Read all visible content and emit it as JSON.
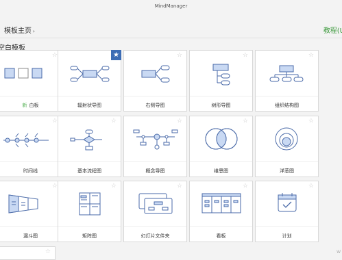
{
  "window": {
    "title": "MindManager"
  },
  "nav": {
    "home_label": "模板主页",
    "chevron": "›",
    "tutorial_label": "教程(U"
  },
  "section": {
    "title": "空白模板"
  },
  "templates": [
    {
      "label": "白板",
      "new_badge": "新",
      "starred": false
    },
    {
      "label": "辐射状导图",
      "starred": true
    },
    {
      "label": "右侧导图",
      "starred": false
    },
    {
      "label": "树形导图",
      "starred": false
    },
    {
      "label": "组织结构图",
      "starred": false
    },
    {
      "label": "时间线",
      "starred": false
    },
    {
      "label": "基本流程图",
      "starred": false
    },
    {
      "label": "概念导图",
      "starred": false
    },
    {
      "label": "维恩图",
      "starred": false
    },
    {
      "label": "洋葱图",
      "starred": false
    },
    {
      "label": "漏斗图",
      "starred": false
    },
    {
      "label": "矩阵图",
      "starred": false
    },
    {
      "label": "幻灯片文件夹",
      "starred": false
    },
    {
      "label": "看板",
      "starred": false
    },
    {
      "label": "计划",
      "starred": false
    }
  ],
  "icons": {
    "favorite": "star-outline-icon",
    "starred": "star-filled-icon"
  },
  "colors": {
    "accent_blue": "#3d6db5",
    "shape_fill": "#c9d9f3",
    "shape_stroke": "#4a6aa8",
    "tutorial_green": "#3d9a3d"
  },
  "watermark": "W"
}
